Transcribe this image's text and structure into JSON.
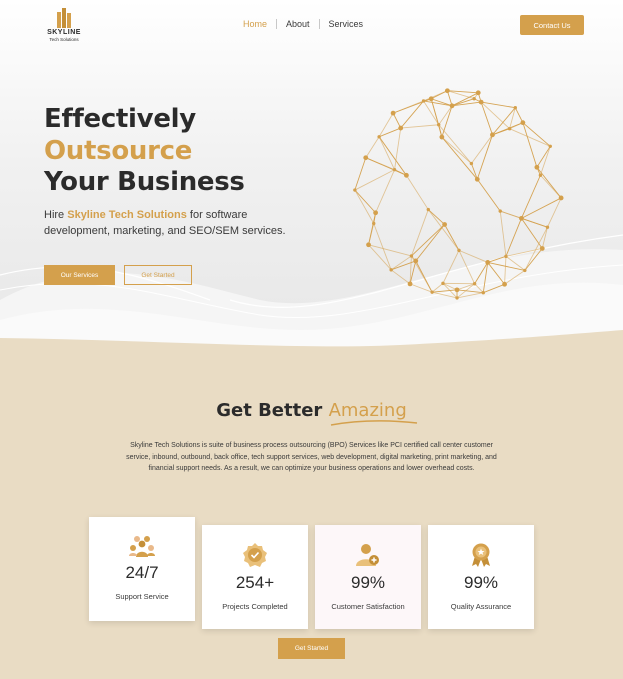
{
  "header": {
    "logo_name": "SKYLINE",
    "logo_sub": "Tech Solutions",
    "nav": [
      "Home",
      "About",
      "Services"
    ],
    "contact_label": "Contact Us"
  },
  "hero": {
    "title_line1": "Effectively",
    "title_line2": "Outsource",
    "title_line3": "Your Business",
    "desc_prefix": "Hire ",
    "desc_brand": "Skyline Tech Solutions",
    "desc_suffix": " for software development, marketing, and SEO/SEM services.",
    "primary_label": "Our Services",
    "secondary_label": "Get Started"
  },
  "about": {
    "title_plain": "Get Better ",
    "title_accent": "Amazing",
    "text": "Skyline Tech Solutions is suite of business process outsourcing (BPO) Services like PCI certified call center customer service, inbound, outbound, back office, tech support services, web development, digital marketing, print marketing, and financial support needs. As a result, we can optimize your business operations and lower overhead costs."
  },
  "stats": [
    {
      "value": "24/7",
      "label": "Support Service",
      "icon": "team-icon"
    },
    {
      "value": "254+",
      "label": "Projects Completed",
      "icon": "check-badge-icon"
    },
    {
      "value": "99%",
      "label": "Customer Satisfaction",
      "icon": "user-plus-icon"
    },
    {
      "value": "99%",
      "label": "Quality Assurance",
      "icon": "award-ribbon-icon"
    }
  ],
  "cta_label": "Get Started",
  "colors": {
    "accent": "#d4a04c",
    "sand": "#e9dcc4",
    "text": "#2b2b2b"
  }
}
